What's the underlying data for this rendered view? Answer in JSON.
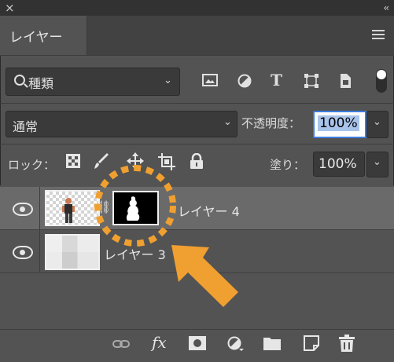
{
  "window": {
    "close_glyph": "×",
    "collapse_glyph": "‹‹"
  },
  "panel": {
    "tab_label": "レイヤー"
  },
  "filter": {
    "selected_label": "種類",
    "icons": [
      "image-filter-icon",
      "adjustment-filter-icon",
      "type-filter-icon",
      "shape-filter-icon",
      "smart-object-filter-icon"
    ]
  },
  "blend": {
    "mode_label": "通常",
    "opacity_label": "不透明度：",
    "opacity_value": "100%"
  },
  "lock": {
    "label": "ロック：",
    "fill_label": "塗り：",
    "fill_value": "100%"
  },
  "layers": [
    {
      "name": "レイヤー 4",
      "selected": true,
      "has_mask": true
    },
    {
      "name": "レイヤー 3",
      "selected": false,
      "has_mask": false
    }
  ],
  "annotation": {
    "highlight_color": "#f0a030"
  }
}
